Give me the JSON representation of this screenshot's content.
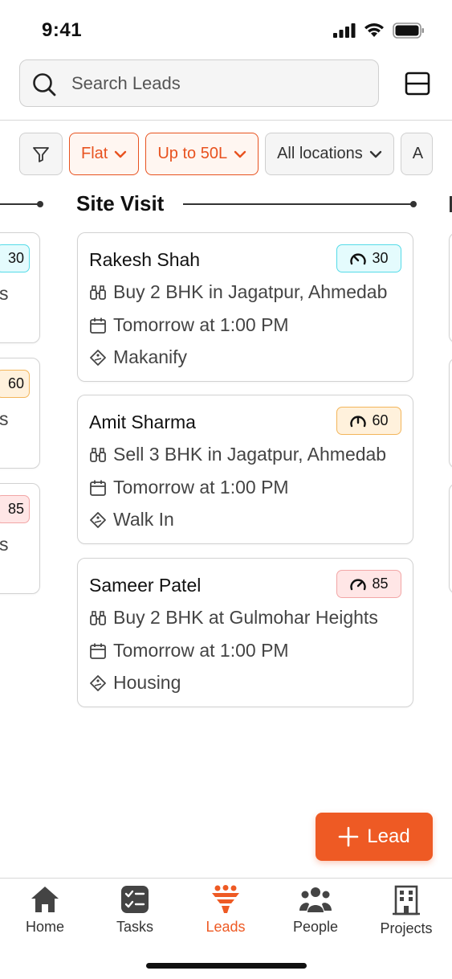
{
  "status_bar": {
    "time": "9:41"
  },
  "search": {
    "placeholder": "Search Leads"
  },
  "filters": {
    "items": [
      {
        "label": "Flat",
        "active": true
      },
      {
        "label": "Up to 50L",
        "active": true
      },
      {
        "label": "All locations",
        "active": false
      },
      {
        "label": "A",
        "active": false
      }
    ]
  },
  "column": {
    "title": "Site Visit"
  },
  "left_column_badges": [
    "30",
    "60",
    "85"
  ],
  "left_column_fragments": [
    "s",
    "s",
    "s"
  ],
  "leads": [
    {
      "name": "Rakesh Shah",
      "score": "30",
      "score_color": "#55dbe8",
      "requirement": "Buy 2 BHK in Jagatpur, Ahmedab",
      "schedule": "Tomorrow at 1:00 PM",
      "source": "Makanify"
    },
    {
      "name": "Amit Sharma",
      "score": "60",
      "score_color": "#f3b55a",
      "requirement": "Sell 3 BHK in Jagatpur, Ahmedab",
      "schedule": "Tomorrow at 1:00 PM",
      "source": "Walk In"
    },
    {
      "name": "Sameer Patel",
      "score": "85",
      "score_color": "#f2a6a6",
      "requirement": "Buy 2 BHK at Gulmohar Heights",
      "schedule": "Tomorrow at 1:00 PM",
      "source": "Housing"
    }
  ],
  "fab": {
    "label": "Lead"
  },
  "nav": {
    "items": [
      {
        "label": "Home",
        "icon": "home-icon"
      },
      {
        "label": "Tasks",
        "icon": "tasks-icon"
      },
      {
        "label": "Leads",
        "icon": "leads-funnel-icon",
        "active": true
      },
      {
        "label": "People",
        "icon": "people-icon"
      },
      {
        "label": "Projects",
        "icon": "building-icon"
      }
    ]
  },
  "colors": {
    "accent": "#ee5a24",
    "accent_border": "#e8521f"
  }
}
